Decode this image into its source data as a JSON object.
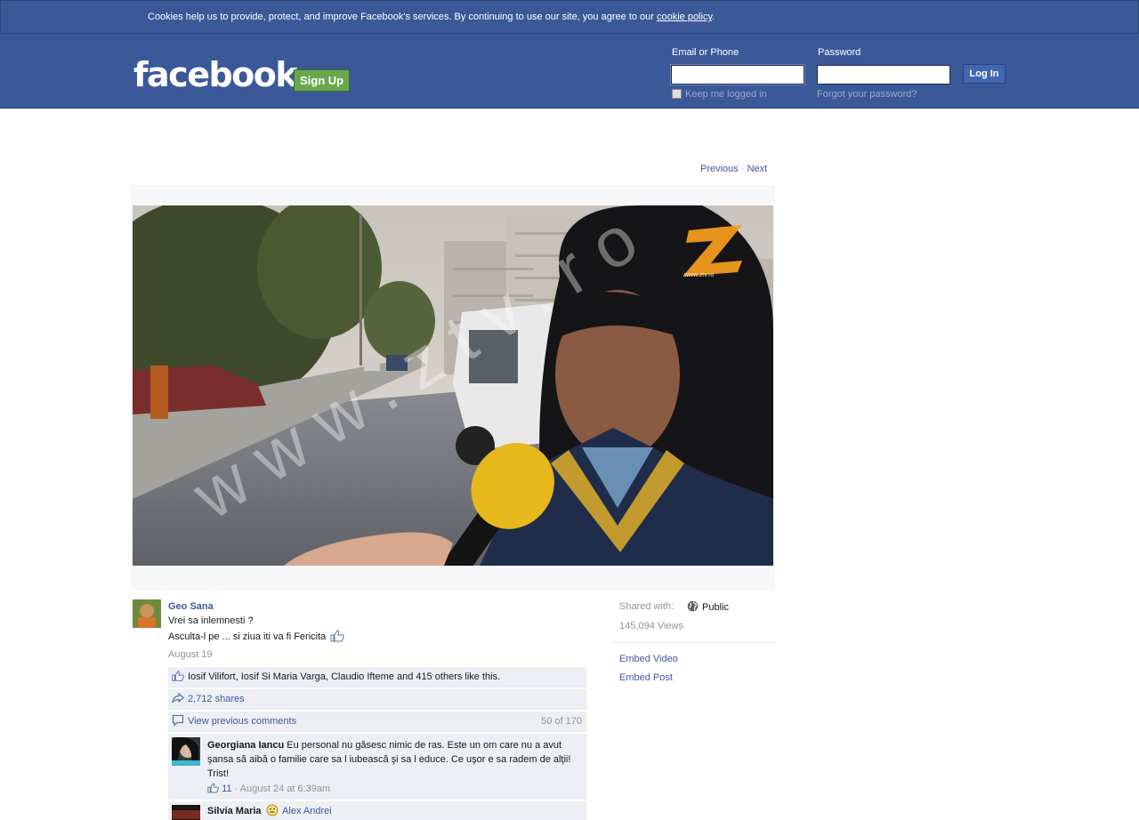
{
  "cookie_banner": {
    "text": "Cookies help us to provide, protect, and improve Facebook's services. By continuing to use our site, you agree to our ",
    "link": "cookie policy",
    "suffix": "."
  },
  "header": {
    "logo": "facebook",
    "signup_label": "Sign Up",
    "email_label": "Email or Phone",
    "email_value": "",
    "password_label": "Password",
    "password_value": "",
    "login_label": "Log In",
    "keep_logged_label": "Keep me logged in",
    "forgot_label": "Forgot your password?",
    "brand_color": "#3b5998"
  },
  "pager": {
    "previous": "Previous",
    "separator": " · ",
    "next": "Next"
  },
  "video": {
    "watermark_logo": "Z",
    "watermark_site": "www.ztv.ro",
    "watermark_diagonal": "www.ztv.ro"
  },
  "post": {
    "author": "Geo Sana",
    "line1": "Vrei sa inlemnesti ?",
    "line2": "Asculta-l pe ... si ziua iti va fi Fericita",
    "date": "August 19",
    "likes": "Iosif Vilifort, Iosif Si Maria Varga, Claudio Ifteme and 415 others like this.",
    "shares": "2,712 shares",
    "view_previous": "View previous comments",
    "comment_count": "50 of 170",
    "comments": [
      {
        "author": "Georgiana Iancu",
        "text": "Eu personal nu găsesc nimic de ras. Este un om care nu a avut şansa să aibă o familie care sa l iubească şi sa l educe. Ce uşor e sa radem de alţii! Trist!",
        "likes": "11",
        "meta": " · August 24 at 6:39am"
      },
      {
        "author": "Silvia Maria",
        "mention": "Alex Andrei"
      }
    ]
  },
  "sidebar": {
    "shared_with_label": "Shared with:",
    "privacy": "Public",
    "views": "145,094 Views",
    "embed_video": "Embed Video",
    "embed_post": "Embed Post"
  }
}
